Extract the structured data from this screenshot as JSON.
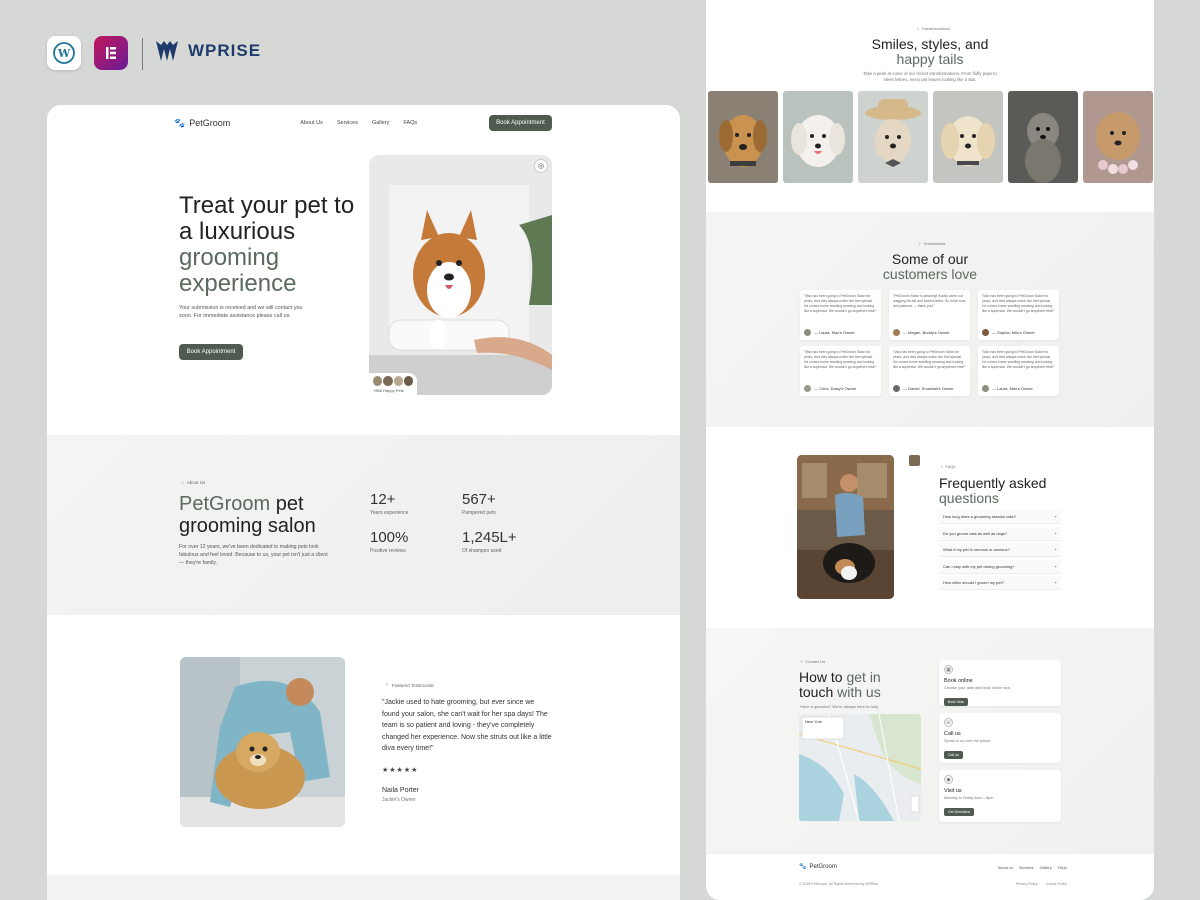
{
  "brand": {
    "wprise": "WPRISE"
  },
  "left": {
    "nav": {
      "logo": "PetGroom",
      "links": [
        "About Us",
        "Services",
        "Gallery",
        "FAQs"
      ],
      "cta": "Book Appointment"
    },
    "hero": {
      "title_dark": "Treat your pet to a luxurious",
      "title_green": "grooming experience",
      "subtitle": "Your submission is received and we will contact you soon. For immediate assistance please call us.",
      "cta": "Book Appointment",
      "happy_pets": "+856 Happy Pets"
    },
    "about": {
      "chip": "About Us",
      "title_green": "PetGroom",
      "title_dark": " pet grooming salon",
      "text": "For over 12 years, we've been dedicated to making pets look fabulous and feel loved. Because to us, your pet isn't just a client — they're family.",
      "stats": [
        {
          "value": "12+",
          "label": "Years experience"
        },
        {
          "value": "567+",
          "label": "Pampered pets"
        },
        {
          "value": "100%",
          "label": "Positive reviews"
        },
        {
          "value": "1,245L+",
          "label": "Of shampoo used"
        }
      ]
    },
    "featured": {
      "chip": "Featured Testimonial",
      "quote": "\"Jackie used to hate grooming, but ever since we found your salon, she can't wait for her spa days! The team is so patient and loving - they've completely changed her experience. Now she struts out like a little diva every time!\"",
      "stars": "★★★★★",
      "name": "Naila Porter",
      "role": "Jackie's Owner"
    }
  },
  "right": {
    "gallery": {
      "chip": "Transformations",
      "title_dark": "Smiles, styles, and",
      "title_green": "happy tails",
      "subtitle": "Take a peek at some of our recent transformations. From fluffy pups to sleek felines, every pet leaves looking like a star."
    },
    "reviews": {
      "chip": "Testimonials",
      "title_dark": "Some of our",
      "title_green": "customers love",
      "items": [
        {
          "text": "\"Max has been going to PetGroom Salon for years, and they always make him feel special. He comes home smelling amazing and looking like a superstar. We wouldn't go anywhere else!\"",
          "author": "— Laura, Max's Owner"
        },
        {
          "text": "\"PetGroom Salon is amazing! Buddy came out wagging his tail and looked better. So much love and patience — thank you!\"",
          "author": "— Megan, Buddy's Owner"
        },
        {
          "text": "\"Max has been going to PetGroom Salon for years, and they always make him feel special. He comes home smelling amazing and looking like a superstar. We wouldn't go anywhere else!\"",
          "author": "— Sophia, Milo's Owner"
        },
        {
          "text": "\"Max has been going to PetGroom Salon for years, and they always make him feel special. He comes home smelling amazing and looking like a superstar. We wouldn't go anywhere else!\"",
          "author": "— Chris, Daisy's Owner"
        },
        {
          "text": "\"Max has been going to PetGroom Salon for years, and they always make him feel special. He comes home smelling amazing and looking like a superstar. We wouldn't go anywhere else!\"",
          "author": "— Daniel, Snowball's Owner"
        },
        {
          "text": "\"Max has been going to PetGroom Salon for years, and they always make him feel special. He comes home smelling amazing and looking like a superstar. We wouldn't go anywhere else!\"",
          "author": "— Laura, Max's Owner"
        }
      ]
    },
    "faq": {
      "chip": "FAQs",
      "title_dark": "Frequently asked",
      "title_green": "questions",
      "items": [
        "How long does a grooming session take?",
        "Do you groom cats as well as dogs?",
        "What if my pet is nervous or anxious?",
        "Can I stay with my pet during grooming?",
        "How often should I groom my pet?"
      ]
    },
    "contact": {
      "chip": "Contact Us",
      "title_dark": "How to ",
      "title_green": "get in",
      "title_dark2": "touch",
      "title_green2": " with us",
      "subtitle": "Have a question? We're always here to help.",
      "map_label": "New York",
      "cards": [
        {
          "title": "Book online",
          "desc": "Choose your date and book online now.",
          "btn": "Book Now"
        },
        {
          "title": "Call us",
          "desc": "Speak to us over the phone",
          "btn": "Call us"
        },
        {
          "title": "Visit us",
          "desc": "Monday to Friday 8am – 8pm",
          "btn": "Get Directions"
        }
      ]
    },
    "footer": {
      "logo": "PetGroom",
      "links": [
        "About us",
        "Services",
        "Gallery",
        "FAQs"
      ],
      "copyright": "© 2025 PetGroom. All Rights Reserved by WPRise",
      "legal": [
        "Privacy Policy",
        "Cookie Policy"
      ]
    }
  }
}
